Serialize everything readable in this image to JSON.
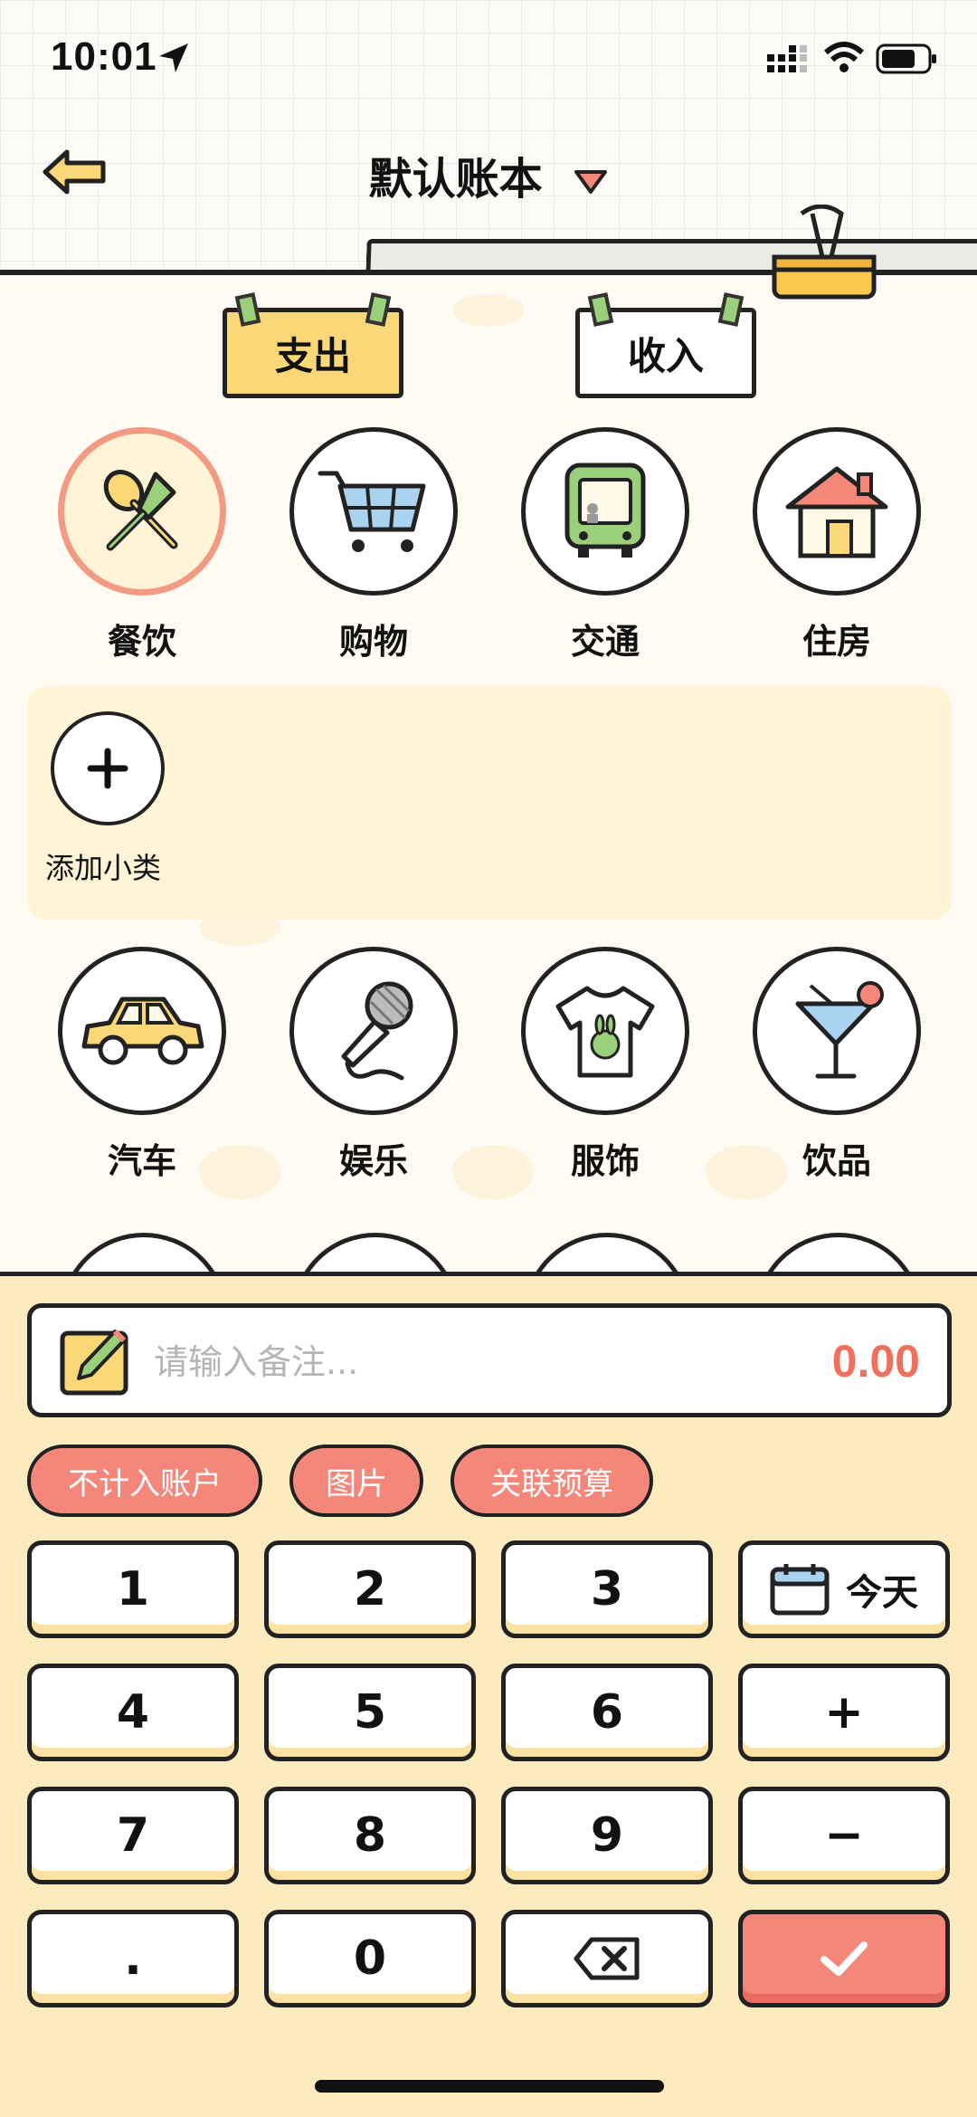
{
  "status": {
    "time": "10:01"
  },
  "header": {
    "ledger_name": "默认账本"
  },
  "tabs": {
    "expense": "支出",
    "income": "收入"
  },
  "categories_top": [
    {
      "label": "餐饮",
      "icon": "utensils-icon",
      "selected": true
    },
    {
      "label": "购物",
      "icon": "cart-icon"
    },
    {
      "label": "交通",
      "icon": "bus-icon"
    },
    {
      "label": "住房",
      "icon": "house-icon"
    }
  ],
  "subcategory": {
    "add_label": "添加小类"
  },
  "categories_bottom": [
    {
      "label": "汽车",
      "icon": "car-icon"
    },
    {
      "label": "娱乐",
      "icon": "microphone-icon"
    },
    {
      "label": "服饰",
      "icon": "tshirt-icon"
    },
    {
      "label": "饮品",
      "icon": "cocktail-icon"
    }
  ],
  "note": {
    "placeholder": "请输入备注...",
    "amount": "0.00"
  },
  "chips": [
    "不计入账户",
    "图片",
    "关联预算"
  ],
  "keys": {
    "k1": "1",
    "k2": "2",
    "k3": "3",
    "date": "今天",
    "k4": "4",
    "k5": "5",
    "k6": "6",
    "plus": "+",
    "k7": "7",
    "k8": "8",
    "k9": "9",
    "minus": "−",
    "dot": ".",
    "k0": "0"
  },
  "colors": {
    "accent": "#f4877a",
    "tab_active": "#fad777",
    "keyboard_bg": "#fdebc0",
    "amount": "#f0705e"
  }
}
